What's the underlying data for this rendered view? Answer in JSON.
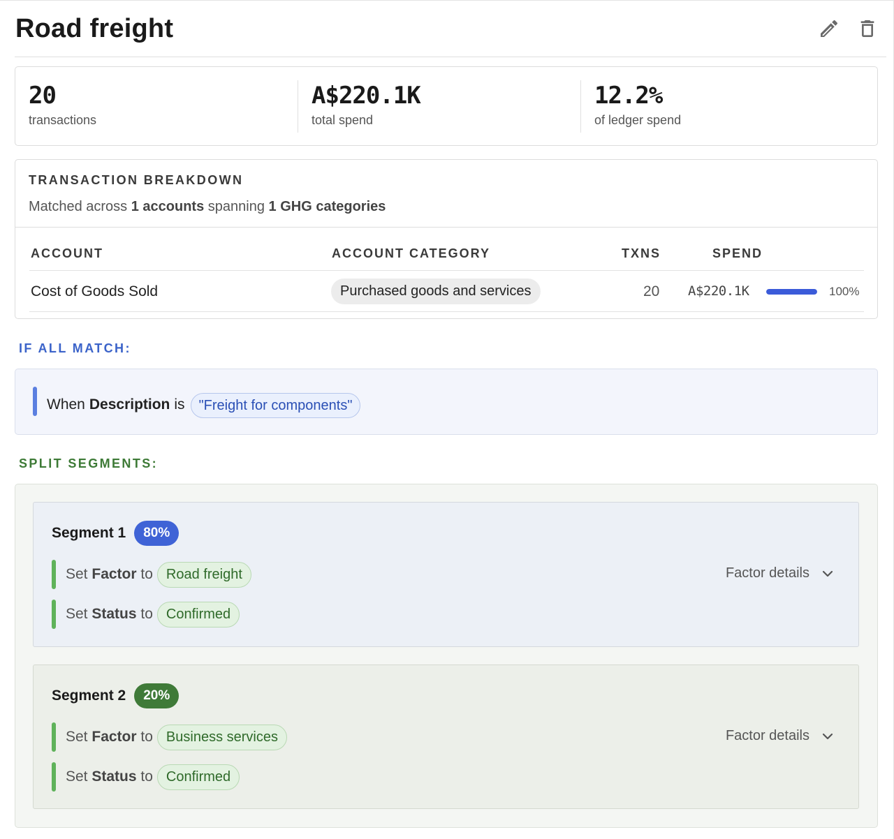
{
  "header": {
    "title": "Road freight",
    "edit_icon": "pencil-icon",
    "delete_icon": "trash-icon"
  },
  "stats": [
    {
      "value": "20",
      "label": "transactions"
    },
    {
      "value": "A$220.1K",
      "label": "total spend"
    },
    {
      "value": "12.2%",
      "label": "of ledger spend"
    }
  ],
  "breakdown": {
    "title": "TRANSACTION BREAKDOWN",
    "subtitle_prefix": "Matched across",
    "accounts_count": "1 accounts",
    "subtitle_middle": "spanning",
    "categories_count": "1 GHG categories",
    "columns": [
      "ACCOUNT",
      "ACCOUNT CATEGORY",
      "TXNS",
      "SPEND"
    ],
    "rows": [
      {
        "account": "Cost of Goods Sold",
        "category": "Purchased goods and services",
        "txns": "20",
        "spend": "A$220.1K",
        "spend_share": 1.0,
        "percent": "100%"
      }
    ]
  },
  "match": {
    "label": "IF ALL MATCH:",
    "when": "When",
    "field": "Description",
    "operator": "is",
    "value": "\"Freight for components\""
  },
  "segments": {
    "label": "SPLIT SEGMENTS:",
    "items": [
      {
        "name": "Segment 1",
        "percent": "80%",
        "factor_set": "Set",
        "factor_field": "Factor",
        "factor_to": "to",
        "factor_value": "Road freight",
        "status_set": "Set",
        "status_field": "Status",
        "status_to": "to",
        "status_value": "Confirmed",
        "details_label": "Factor details"
      },
      {
        "name": "Segment 2",
        "percent": "20%",
        "factor_set": "Set",
        "factor_field": "Factor",
        "factor_to": "to",
        "factor_value": "Business services",
        "status_set": "Set",
        "status_field": "Status",
        "status_to": "to",
        "status_value": "Confirmed",
        "details_label": "Factor details"
      }
    ]
  },
  "colors": {
    "accent_blue": "#3f63d6",
    "accent_green": "#3f7a38",
    "bar_fill": "#3b5bd9"
  }
}
